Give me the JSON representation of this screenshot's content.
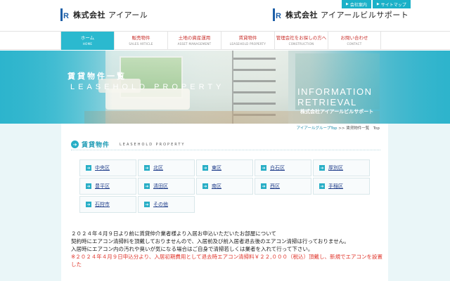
{
  "header": {
    "logo_left": {
      "mark": "R",
      "company_type": "株式会社",
      "name": "アイアール"
    },
    "logo_right": {
      "mark": "R",
      "company_type": "株式会社",
      "name": "アイアールビルサポート"
    },
    "top_links": [
      {
        "label": "会社案内"
      },
      {
        "label": "サイトマップ"
      }
    ]
  },
  "nav": {
    "items": [
      {
        "jp": "ホーム",
        "en": "HOME",
        "active": true
      },
      {
        "jp": "販売物件",
        "en": "SALES ARTICLE",
        "active": false
      },
      {
        "jp": "土地の資産運用",
        "en": "ASSET MANAGEMENT",
        "active": false
      },
      {
        "jp": "賃貸物件",
        "en": "LEASEHOLD PROPERTY",
        "active": false
      },
      {
        "jp": "管理会社をお探しの方へ",
        "en": "CONSTRUCTION",
        "active": false
      },
      {
        "jp": "お問い合わせ",
        "en": "CONTACT",
        "active": false
      }
    ]
  },
  "banner": {
    "title": "賃貸物件一覧",
    "subtitle": "LEASEHOLD PROPERTY",
    "info_line1": "INFORMATION",
    "info_line2": "RETRIEVAL",
    "company": "株式会社アイアールビルサポート"
  },
  "breadcrumb": {
    "link": "アイアールグループTop",
    "sep": ">>",
    "current": "賃貸物件一覧　Top"
  },
  "section": {
    "title": "賃貸物件",
    "subtitle": "LEASEHOLD PROPERTY"
  },
  "districts": [
    {
      "label": "中央区"
    },
    {
      "label": "北区"
    },
    {
      "label": "東区"
    },
    {
      "label": "白石区"
    },
    {
      "label": "厚別区"
    },
    {
      "label": "豊平区"
    },
    {
      "label": "清田区"
    },
    {
      "label": "南区"
    },
    {
      "label": "西区"
    },
    {
      "label": "手稲区"
    },
    {
      "label": "石狩市"
    },
    {
      "label": "その他"
    }
  ],
  "notice": {
    "line1": "２０２４年４月９日より前に賃貸仲介業者様より入居お申込いただいたお部屋について",
    "line2": "契約時にエアコン清掃料を頂戴しておりませんので、入居前及び前入居者退去後のエアコン清掃は行っておりません。",
    "line3": "入居時にエアコン内の汚れや臭いが気になる場合はご自身で清掃若しくは業者を入れて行って下さい。",
    "line4": "※２０２４年４月９日申込分より、入居初期費用として退去時エアコン清掃料￥２２,０００（税込）頂戴し、新規でエアコンを設置した"
  },
  "colors": {
    "accent": "#27aec6",
    "nav_text": "#c9302c",
    "warning": "#e0352b"
  }
}
